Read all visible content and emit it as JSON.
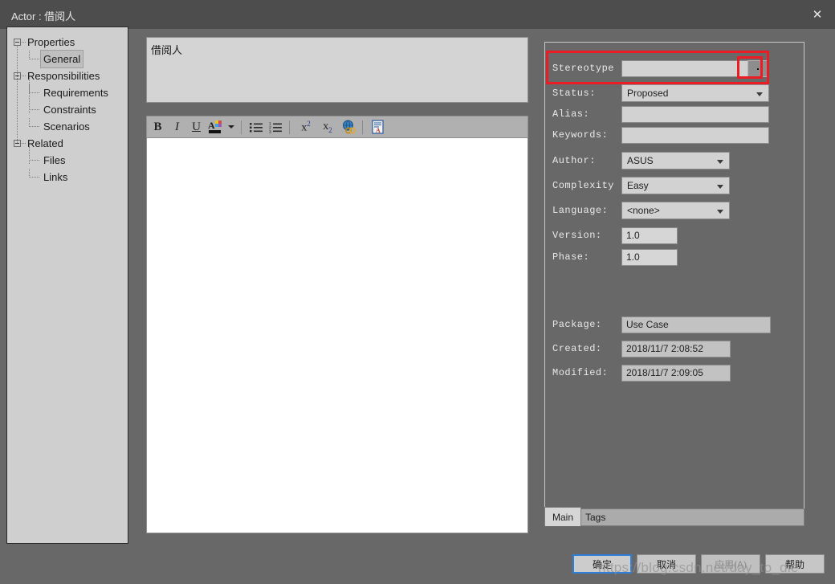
{
  "window": {
    "title": "Actor : 借阅人",
    "close_icon": "close-icon"
  },
  "sidebar": {
    "items": [
      {
        "label": "Properties",
        "level": 0,
        "expandable": true,
        "selected": false
      },
      {
        "label": "General",
        "level": 1,
        "expandable": false,
        "selected": true
      },
      {
        "label": "Responsibilities",
        "level": 0,
        "expandable": true,
        "selected": false
      },
      {
        "label": "Requirements",
        "level": 1,
        "expandable": false,
        "selected": false
      },
      {
        "label": "Constraints",
        "level": 1,
        "expandable": false,
        "selected": false
      },
      {
        "label": "Scenarios",
        "level": 1,
        "expandable": false,
        "selected": false
      },
      {
        "label": "Related",
        "level": 0,
        "expandable": true,
        "selected": false
      },
      {
        "label": "Files",
        "level": 1,
        "expandable": false,
        "selected": false
      },
      {
        "label": "Links",
        "level": 1,
        "expandable": false,
        "selected": false
      }
    ]
  },
  "name_field": {
    "value": "借阅人",
    "placeholder": ""
  },
  "rtf_toolbar": {
    "buttons": [
      {
        "name": "bold-icon",
        "glyph": "B"
      },
      {
        "name": "italic-icon",
        "glyph": "I"
      },
      {
        "name": "underline-icon",
        "glyph": "U"
      },
      {
        "name": "font-color-icon",
        "glyph": "A"
      },
      {
        "name": "font-color-dropdown-icon",
        "glyph": "▾"
      },
      {
        "name": "bullet-list-icon",
        "glyph": "•≡"
      },
      {
        "name": "numbered-list-icon",
        "glyph": "1≡"
      },
      {
        "name": "superscript-icon",
        "glyph": "x²"
      },
      {
        "name": "subscript-icon",
        "glyph": "x₂"
      },
      {
        "name": "hyperlink-icon",
        "glyph": "🌐"
      },
      {
        "name": "insert-document-icon",
        "glyph": "📄"
      }
    ]
  },
  "editor": {
    "content": ""
  },
  "properties": {
    "stereotype": {
      "label": "Stereotype",
      "value": "",
      "browse_label": "."
    },
    "status": {
      "label": "Status:",
      "value": "Proposed"
    },
    "alias": {
      "label": "Alias:",
      "value": ""
    },
    "keywords": {
      "label": "Keywords:",
      "value": ""
    },
    "author": {
      "label": "Author:",
      "value": "ASUS"
    },
    "complexity": {
      "label": "Complexity",
      "value": "Easy"
    },
    "language": {
      "label": "Language:",
      "value": "<none>"
    },
    "version": {
      "label": "Version:",
      "value": "1.0"
    },
    "phase": {
      "label": "Phase:",
      "value": "1.0"
    },
    "package": {
      "label": "Package:",
      "value": "Use Case"
    },
    "created": {
      "label": "Created:",
      "value": "2018/11/7 2:08:52"
    },
    "modified": {
      "label": "Modified:",
      "value": "2018/11/7 2:09:05"
    }
  },
  "tabs": [
    {
      "label": "Main",
      "active": true
    },
    {
      "label": "Tags",
      "active": false
    }
  ],
  "buttons": {
    "ok": "确定",
    "cancel": "取消",
    "apply": "应用(A)",
    "help": "帮助"
  },
  "watermark": "https://blog.csdn.net/day_to_die",
  "colors": {
    "window_bg": "#686868",
    "titlebar": "#4d4d4d",
    "panel": "#cfcfcf",
    "field": "#d2d2d2",
    "highlight_red": "#ec1c24",
    "focus_blue": "#2f7fd8"
  }
}
